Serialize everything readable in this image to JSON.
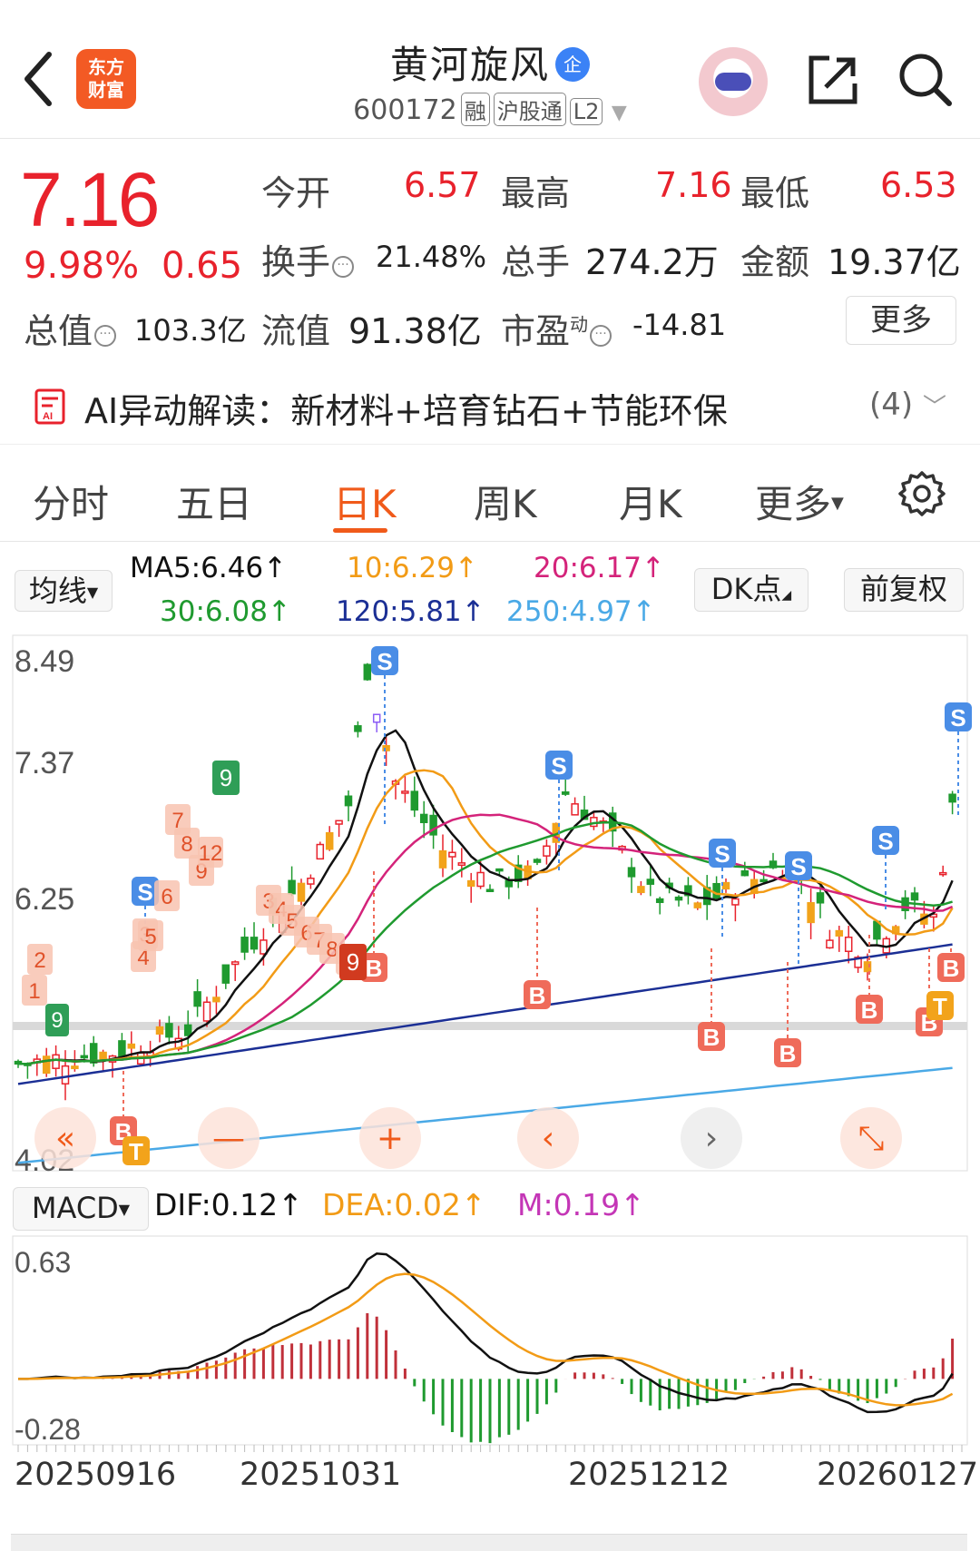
{
  "header": {
    "logo_line1": "东方",
    "logo_line2": "财富",
    "stock_name": "黄河旋风",
    "badge": "企",
    "code": "600172",
    "tags": [
      "融",
      "沪股通",
      "L2"
    ]
  },
  "quote": {
    "price": "7.16",
    "change_pct": "9.98%",
    "change": "0.65",
    "open_label": "今开",
    "open": "6.57",
    "high_label": "最高",
    "high": "7.16",
    "low_label": "最低",
    "low": "6.53",
    "turnover_label": "换手",
    "turnover": "21.48%",
    "volume_label": "总手",
    "volume": "274.2万",
    "amount_label": "金额",
    "amount": "19.37亿",
    "mktcap_label": "总值",
    "mktcap": "103.3亿",
    "float_label": "流值",
    "float": "91.38亿",
    "pe_label": "市盈",
    "pe_sup": "动",
    "pe": "-14.81",
    "more_label": "更多"
  },
  "ai": {
    "text": "AI异动解读：新材料+培育钻石+节能环保",
    "count": "(4)"
  },
  "tabs": [
    "分时",
    "五日",
    "日K",
    "周K",
    "月K",
    "更多"
  ],
  "active_tab": "日K",
  "chart_controls": {
    "ma_button": "均线",
    "dk_button": "DK点",
    "adjust_button": "前复权",
    "macd_button": "MACD"
  },
  "ma_legend": {
    "ma5": "MA5:6.46↑",
    "ma10": "10:6.29↑",
    "ma20": "20:6.17↑",
    "ma30": "30:6.08↑",
    "ma120": "120:5.81↑",
    "ma250": "250:4.97↑"
  },
  "macd_legend": {
    "dif": "DIF:0.12↑",
    "dea": "DEA:0.02↑",
    "m": "M:0.19↑"
  },
  "colors": {
    "up": "#e8222c",
    "down": "#1f9a2f",
    "ma5": "#111111",
    "ma10": "#f29b16",
    "ma20": "#d4237a",
    "ma30": "#1f9a2f",
    "ma120": "#1b2f95",
    "ma250": "#4aa9e6",
    "accent": "#f05a1a"
  },
  "chart_data": {
    "type": "candlestick",
    "y_ticks": [
      "8.49",
      "7.37",
      "6.25",
      "4.02"
    ],
    "macd_y_ticks": [
      "0.63",
      "-0.28"
    ],
    "x_ticks": [
      "20250916",
      "20251031",
      "20251212",
      "20260127"
    ],
    "signals": [
      "1",
      "2",
      "3",
      "4",
      "5",
      "6",
      "7",
      "8",
      "9",
      "12",
      "3",
      "4",
      "5",
      "6",
      "7",
      "8",
      "9",
      "S",
      "B",
      "T"
    ]
  }
}
